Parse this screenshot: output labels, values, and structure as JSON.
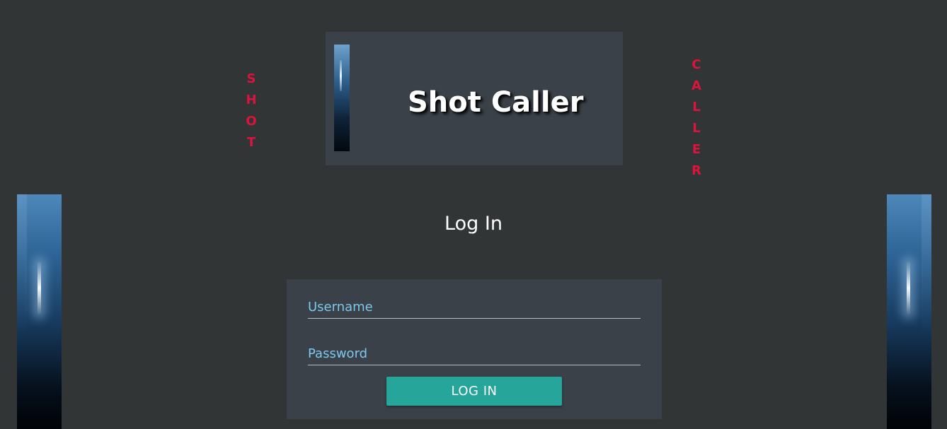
{
  "header": {
    "title": "Shot Caller"
  },
  "decor": {
    "left_letters": [
      "S",
      "H",
      "O",
      "T"
    ],
    "right_letters": [
      "C",
      "A",
      "L",
      "L",
      "E",
      "R"
    ],
    "accent_color": "#dc143c"
  },
  "login": {
    "heading": "Log In",
    "username_placeholder": "Username",
    "password_placeholder": "Password",
    "button_label": "LOG IN",
    "button_color": "#26a69a",
    "placeholder_color": "#7dc8ec"
  },
  "colors": {
    "page_background": "#323536",
    "card_background": "#3a4148"
  }
}
